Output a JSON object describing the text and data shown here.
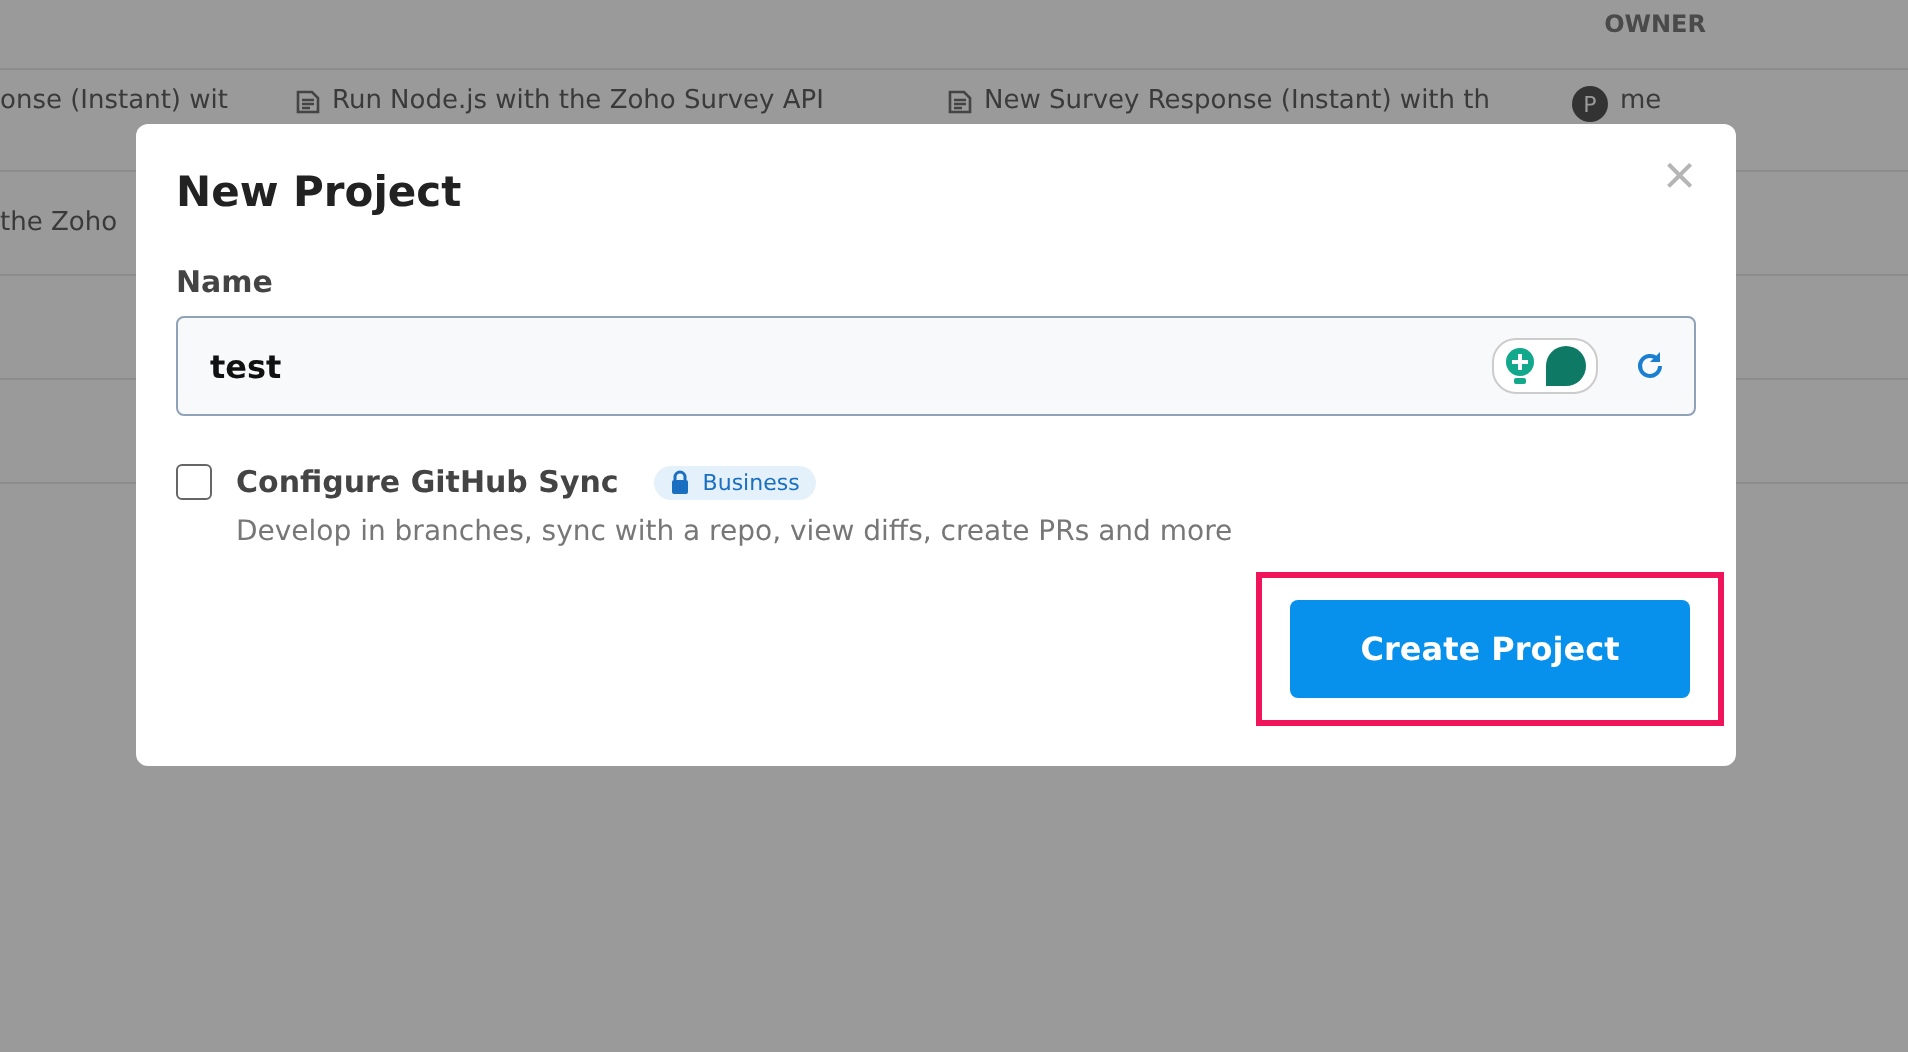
{
  "table": {
    "columns": [
      {
        "label": "OWNER"
      }
    ],
    "rows": [
      {
        "cells": [
          "onse (Instant) wit",
          "Run Node.js with the Zoho Survey API",
          "New Survey Response (Instant) with th"
        ],
        "owner_initial": "P",
        "owner": "me"
      },
      {
        "cells": [
          "the Zoho"
        ]
      }
    ]
  },
  "dialog": {
    "title": "New Project",
    "close": "×",
    "name_label": "Name",
    "name_value": "test",
    "github_sync": {
      "label": "Configure GitHub Sync",
      "checked": false,
      "badge": "Business",
      "description": "Develop in branches, sync with a repo, view diffs, create PRs and more"
    },
    "primary_button": {
      "label": "Create Project",
      "highlighted": true
    }
  }
}
